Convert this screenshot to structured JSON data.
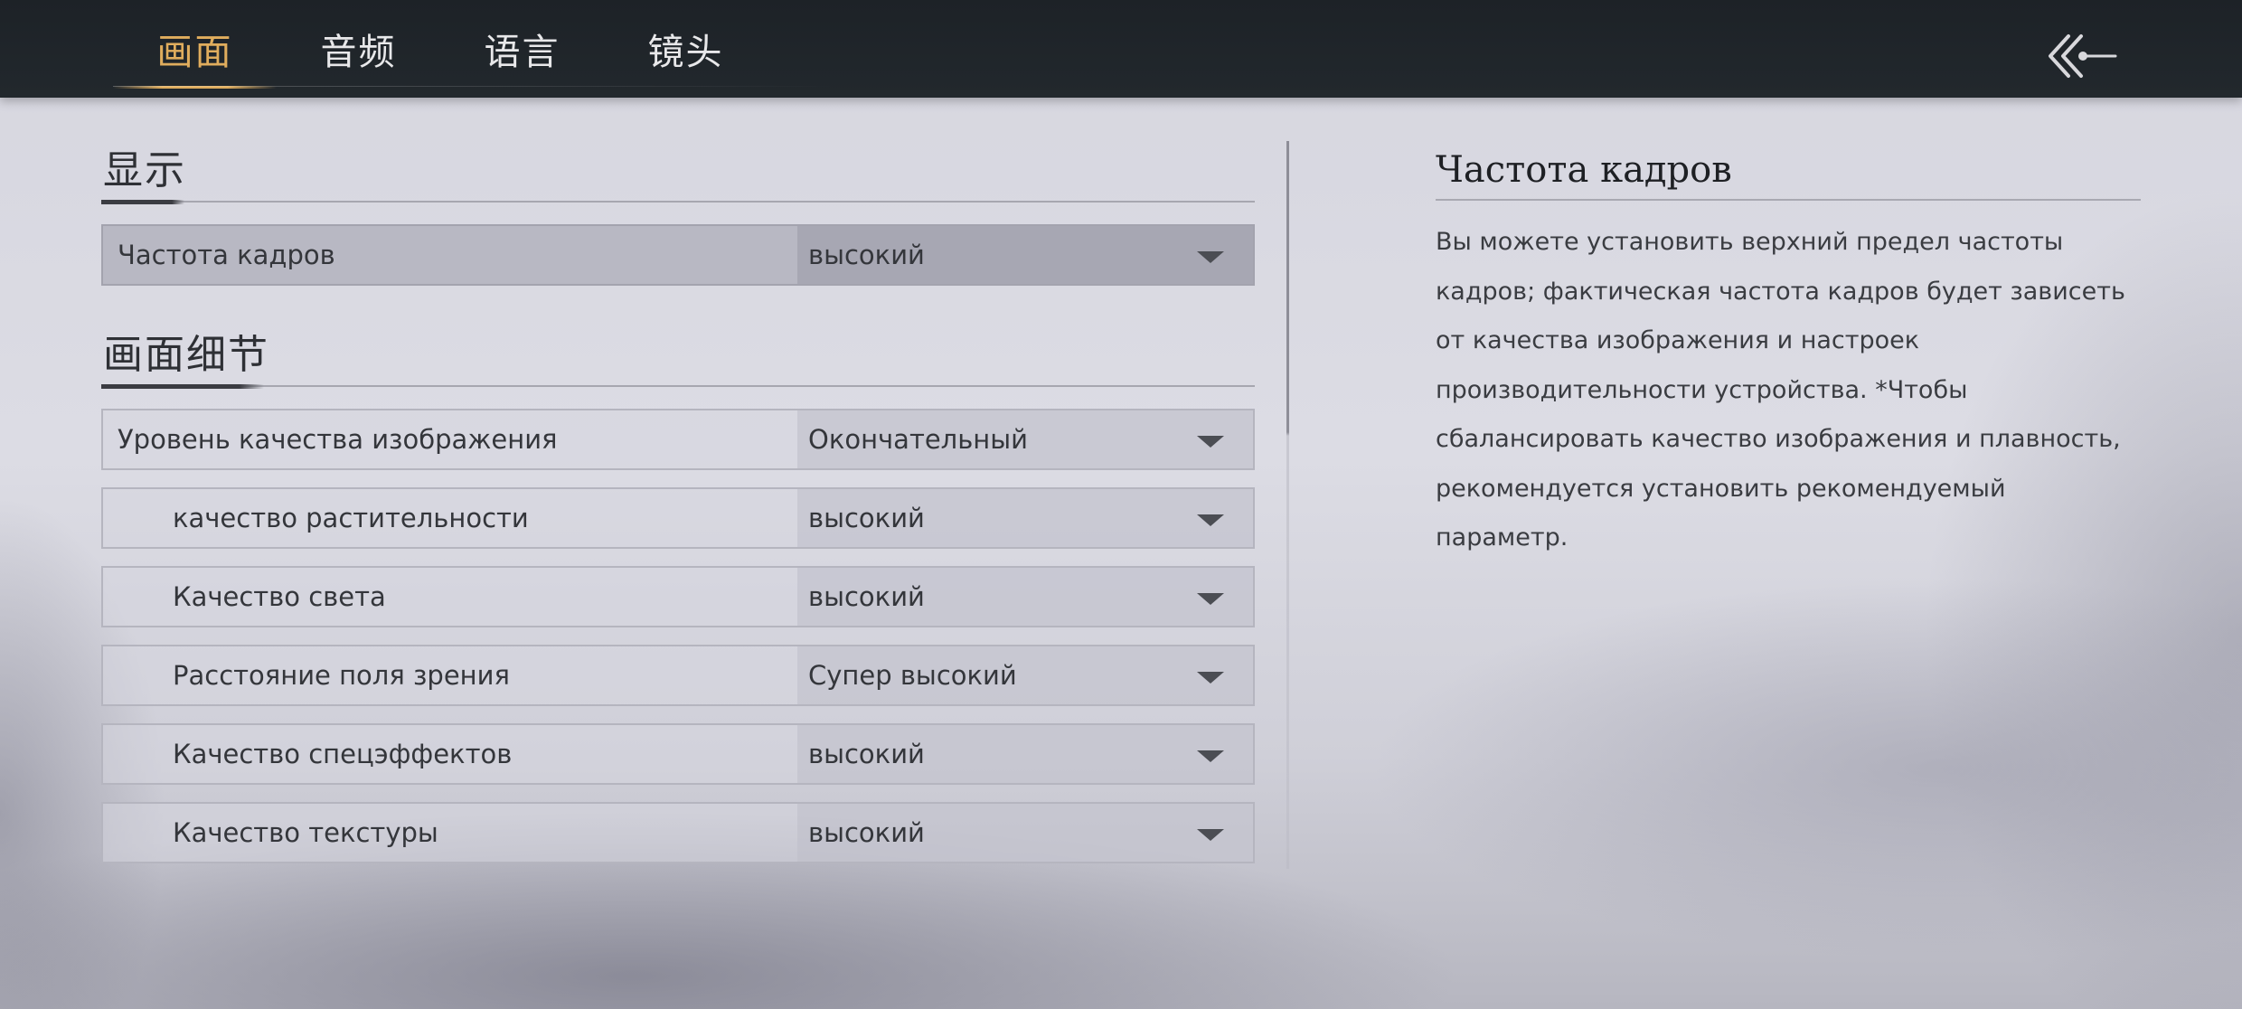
{
  "tabs": [
    {
      "label": "画面",
      "active": true
    },
    {
      "label": "音频",
      "active": false
    },
    {
      "label": "语言",
      "active": false
    },
    {
      "label": "镜头",
      "active": false
    }
  ],
  "back_icon": "double-chevron-left-icon",
  "sections": {
    "display": {
      "title": "显示",
      "rows": [
        {
          "label": "Частота кадров",
          "value": "высокий"
        }
      ]
    },
    "detail": {
      "title": "画面细节",
      "rows": [
        {
          "label": "Уровень качества изображения",
          "value": "Окончательный"
        },
        {
          "label": "качество растительности",
          "value": "высокий"
        },
        {
          "label": "Качество света",
          "value": "высокий"
        },
        {
          "label": "Расстояние поля зрения",
          "value": "Супер высокий"
        },
        {
          "label": "Качество спецэффектов",
          "value": "высокий"
        },
        {
          "label": "Качество текстуры",
          "value": "высокий"
        }
      ]
    }
  },
  "description": {
    "title": "Частота кадров",
    "text": "Вы можете установить верхний предел частоты кадров; фактическая частота кадров будет зависеть от качества изображения и настроек производительности устройства. *Чтобы сбалансировать качество изображения и плавность, рекомендуется установить рекомендуемый параметр."
  },
  "colors": {
    "accent": "#e0ad5d",
    "topbar": "#1d2227",
    "text": "#34363b"
  }
}
